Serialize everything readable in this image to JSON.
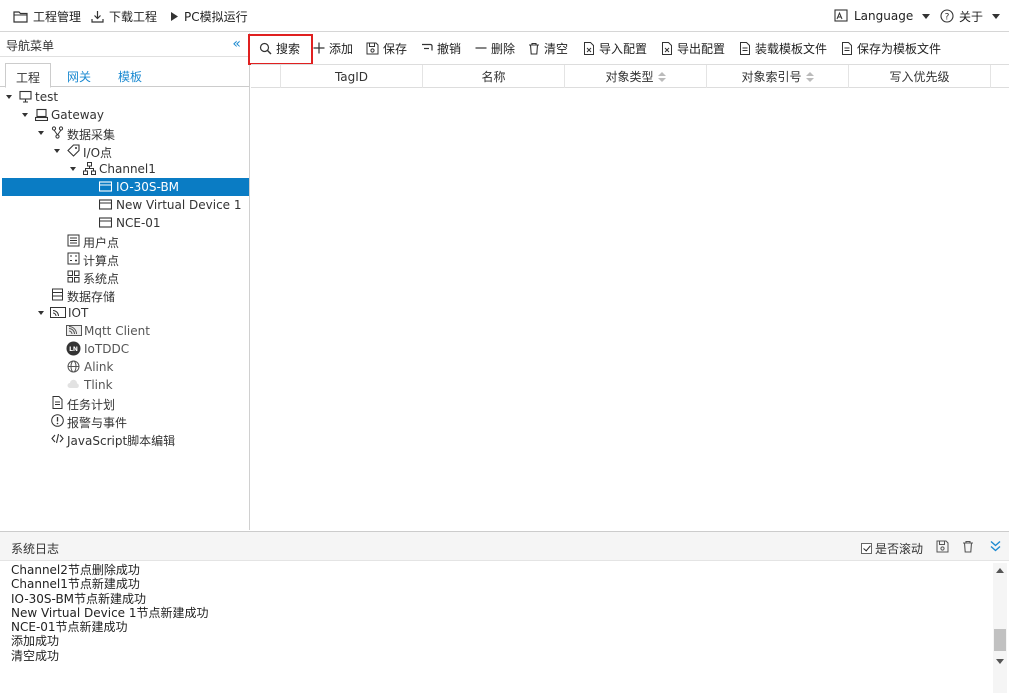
{
  "topbar": {
    "project_mgmt": "工程管理",
    "download": "下载工程",
    "pc_sim": "PC模拟运行",
    "language": "Language",
    "about": "关于"
  },
  "nav": {
    "title": "导航菜单",
    "tabs": [
      "工程",
      "网关",
      "模板"
    ]
  },
  "tree": [
    {
      "label": "test",
      "icon": "monitor-icon"
    },
    {
      "label": "Gateway",
      "icon": "gateway-icon"
    },
    {
      "label": "数据采集",
      "icon": "branch-icon"
    },
    {
      "label": "I/O点",
      "icon": "tag-icon"
    },
    {
      "label": "Channel1",
      "icon": "network-icon"
    },
    {
      "label": "IO-30S-BM",
      "icon": "device-icon"
    },
    {
      "label": "New Virtual Device 1",
      "icon": "device-icon"
    },
    {
      "label": "NCE-01",
      "icon": "device-icon"
    },
    {
      "label": "用户点",
      "icon": "list-icon"
    },
    {
      "label": "计算点",
      "icon": "calc-icon"
    },
    {
      "label": "系统点",
      "icon": "grid-icon"
    },
    {
      "label": "数据存储",
      "icon": "storage-icon"
    },
    {
      "label": "IOT",
      "icon": "iot-icon"
    },
    {
      "label": "Mqtt Client",
      "icon": "mqtt-icon"
    },
    {
      "label": "IoTDDC",
      "icon": "iotddc-icon"
    },
    {
      "label": "Alink",
      "icon": "globe-icon"
    },
    {
      "label": "Tlink",
      "icon": "cloud-icon"
    },
    {
      "label": "任务计划",
      "icon": "doc-icon"
    },
    {
      "label": "报警与事件",
      "icon": "alert-icon"
    },
    {
      "label": "JavaScript脚本编辑",
      "icon": "code-icon"
    }
  ],
  "toolbar": {
    "search": "搜索",
    "add": "添加",
    "save": "保存",
    "undo": "撤销",
    "delete": "删除",
    "clear": "清空",
    "import": "导入配置",
    "export": "导出配置",
    "load_template": "装载模板文件",
    "save_template": "保存为模板文件"
  },
  "grid": {
    "columns": [
      "TagID",
      "名称",
      "对象类型",
      "对象索引号",
      "写入优先级"
    ]
  },
  "log": {
    "title": "系统日志",
    "scroll_label": "是否滚动",
    "lines": [
      "Channel2节点删除成功",
      "Channel1节点新建成功",
      "IO-30S-BM节点新建成功",
      "New Virtual Device 1节点新建成功",
      "NCE-01节点新建成功",
      "添加成功",
      "清空成功"
    ]
  }
}
